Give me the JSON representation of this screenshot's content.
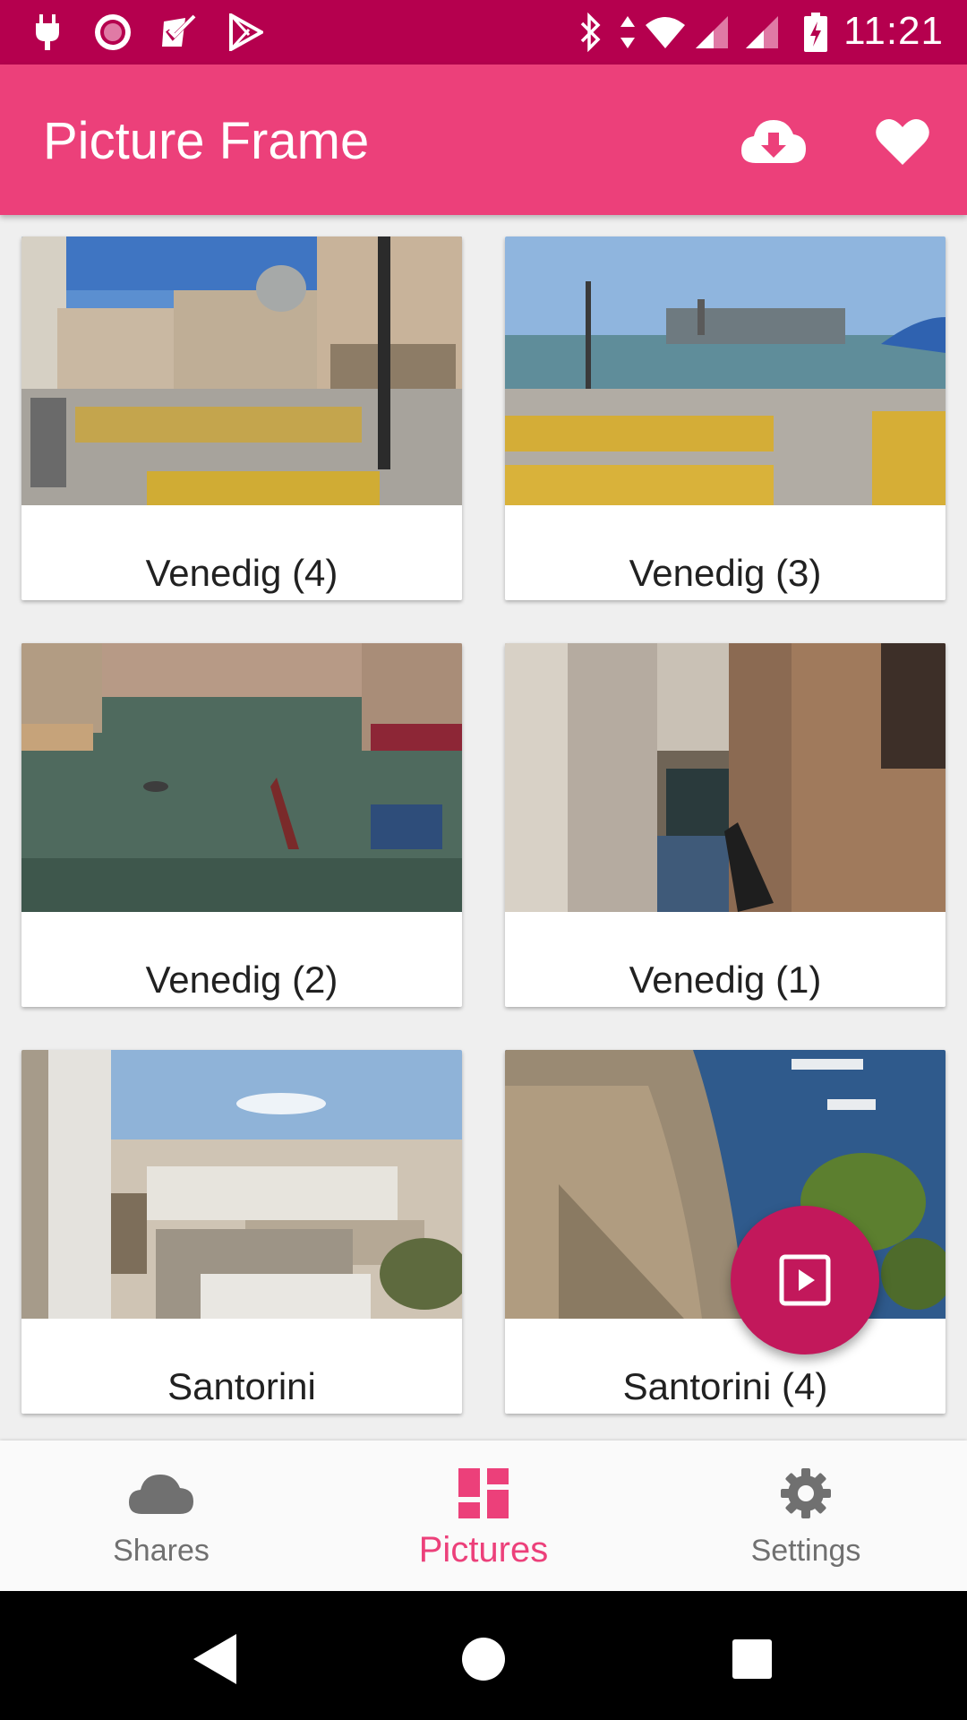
{
  "status_bar": {
    "time": "11:21",
    "left_icons": [
      "plug-icon",
      "record-icon",
      "task-check-icon",
      "play-store-icon"
    ],
    "right_icons": [
      "bluetooth-icon",
      "data-arrows-icon",
      "wifi-icon",
      "signal-icon",
      "signal-icon",
      "battery-charging-icon"
    ]
  },
  "app_bar": {
    "title": "Picture Frame",
    "actions": [
      "cloud-download-icon",
      "heart-icon"
    ]
  },
  "pictures": [
    {
      "caption": "Venedig (4)"
    },
    {
      "caption": "Venedig (3)"
    },
    {
      "caption": "Venedig (2)"
    },
    {
      "caption": "Venedig (1)"
    },
    {
      "caption": "Santorini"
    },
    {
      "caption": "Santorini (4)"
    }
  ],
  "fab": {
    "icon": "slideshow-icon"
  },
  "bottom_nav": {
    "items": [
      {
        "label": "Shares",
        "icon": "cloud-icon",
        "active": false
      },
      {
        "label": "Pictures",
        "icon": "dashboard-icon",
        "active": true
      },
      {
        "label": "Settings",
        "icon": "gear-icon",
        "active": false
      }
    ]
  },
  "colors": {
    "status_bar": "#b5004e",
    "app_bar": "#ec407a",
    "fab": "#c2185b",
    "nav_active": "#ec407a",
    "nav_inactive": "#707070"
  }
}
